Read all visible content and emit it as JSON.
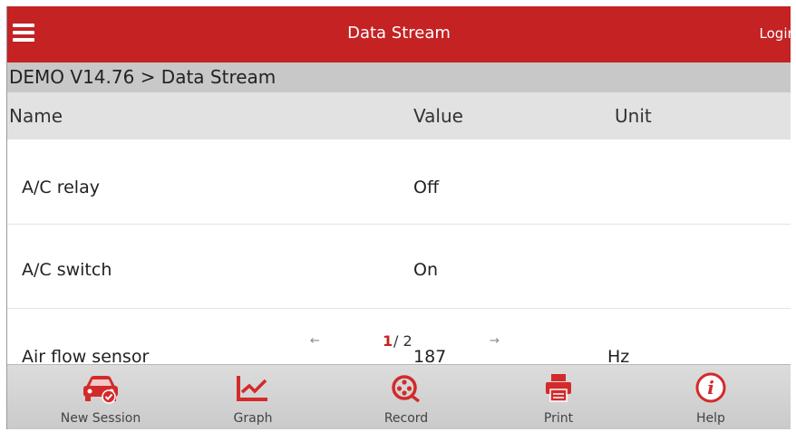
{
  "appbar": {
    "title": "Data Stream",
    "login_label": "Login"
  },
  "breadcrumb": "DEMO V14.76 > Data Stream",
  "table": {
    "headers": {
      "name": "Name",
      "value": "Value",
      "unit": "Unit"
    },
    "rows": [
      {
        "name": "A/C relay",
        "value": "Off",
        "unit": ""
      },
      {
        "name": "A/C switch",
        "value": "On",
        "unit": ""
      },
      {
        "name": "Air flow sensor",
        "value": "187",
        "unit": "Hz"
      }
    ]
  },
  "pager": {
    "prev": "←",
    "next": "→",
    "current": "1",
    "total": "/ 2"
  },
  "toolbar": [
    {
      "label": "New Session",
      "icon": "car-check-icon"
    },
    {
      "label": "Graph",
      "icon": "graph-icon"
    },
    {
      "label": "Record",
      "icon": "record-reel-icon"
    },
    {
      "label": "Print",
      "icon": "printer-icon"
    },
    {
      "label": "Help",
      "icon": "info-icon"
    }
  ],
  "colors": {
    "accent": "#c42223",
    "toolbar_bg": "#d4d4d4",
    "header_bg": "#e2e2e2",
    "breadcrumb_bg": "#c8c8c8"
  }
}
